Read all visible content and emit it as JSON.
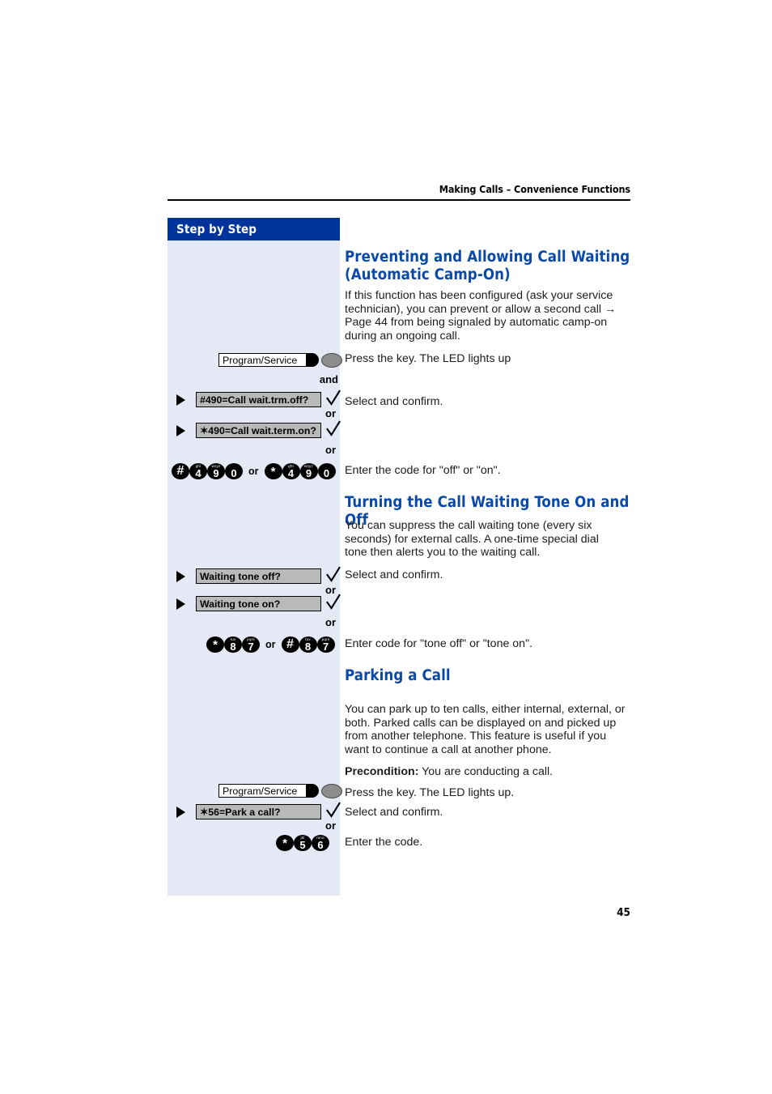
{
  "header": {
    "running_head": "Making Calls – Convenience Functions"
  },
  "sidebar": {
    "title": "Step by Step"
  },
  "page": {
    "number": "45"
  },
  "sections": [
    {
      "heading_line1": "Preventing and Allowing Call Waiting",
      "heading_line2": "(Automatic Camp-On)",
      "intro": "If this function has been configured (ask your service technician), you can prevent or allow a second call → Page 44 from being signaled by automatic camp-on during an ongoing call.",
      "step_press_key": "Press the key. The LED lights up",
      "step_select_confirm": "Select and confirm.",
      "step_enter_code": "Enter the code for \"off\" or \"on\"."
    },
    {
      "heading_line1": "Turning the Call Waiting Tone On and Off",
      "intro": "You can suppress the call waiting tone (every six seconds) for external calls. A one-time special dial tone then alerts you to the waiting call.",
      "step_select_confirm": "Select and confirm.",
      "step_enter_code": "Enter code for \"tone off\" or \"tone on\"."
    },
    {
      "heading_line1": "Parking a Call",
      "intro": "You can park up to ten calls, either internal, external, or both. Parked calls can be displayed on and picked up from another telephone. This feature is useful if you want to continue a call at another phone.",
      "precondition_label": "Precondition:",
      "precondition_text": " You are conducting a call.",
      "step_press_key": "Press the key. The LED lights up.",
      "step_select_confirm": "Select and confirm.",
      "step_enter_code": "Enter the code."
    }
  ],
  "function_keys": {
    "program_service": "Program/Service"
  },
  "display_options": {
    "call_wait_trm_off": "#490=Call wait.trm.off?",
    "call_wait_term_on": "✶490=Call wait.term.on?",
    "waiting_tone_off": "Waiting tone off?",
    "waiting_tone_on": "Waiting tone on?",
    "park_a_call": "✶56=Park a call?"
  },
  "connectors": {
    "and": "and",
    "or": "or"
  },
  "keypad_sequences": [
    {
      "id": "camp-on-codes",
      "groups": [
        {
          "keys": [
            {
              "glyph": "#",
              "letters": ""
            },
            {
              "glyph": "4",
              "letters": "ghi"
            },
            {
              "glyph": "9",
              "letters": "wxyz"
            },
            {
              "glyph": "0",
              "letters": ""
            }
          ]
        },
        {
          "keys": [
            {
              "glyph": "*",
              "letters": ""
            },
            {
              "glyph": "4",
              "letters": "ghi"
            },
            {
              "glyph": "9",
              "letters": "wxyz"
            },
            {
              "glyph": "0",
              "letters": ""
            }
          ]
        }
      ]
    },
    {
      "id": "waiting-tone-codes",
      "groups": [
        {
          "keys": [
            {
              "glyph": "*",
              "letters": ""
            },
            {
              "glyph": "8",
              "letters": "tuv"
            },
            {
              "glyph": "7",
              "letters": "pqrs"
            }
          ]
        },
        {
          "keys": [
            {
              "glyph": "#",
              "letters": ""
            },
            {
              "glyph": "8",
              "letters": "tuv"
            },
            {
              "glyph": "7",
              "letters": "pqrs"
            }
          ]
        }
      ]
    },
    {
      "id": "park-code",
      "groups": [
        {
          "keys": [
            {
              "glyph": "*",
              "letters": ""
            },
            {
              "glyph": "5",
              "letters": "jkl"
            },
            {
              "glyph": "6",
              "letters": "mno"
            }
          ]
        }
      ]
    }
  ],
  "colors": {
    "sidebar_bg": "#e4e9f5",
    "sidebar_header_bg": "#00349a",
    "heading_blue": "#0a49a8",
    "display_box_bg": "#b9b9b9",
    "led_gray": "#8d8d8d"
  }
}
